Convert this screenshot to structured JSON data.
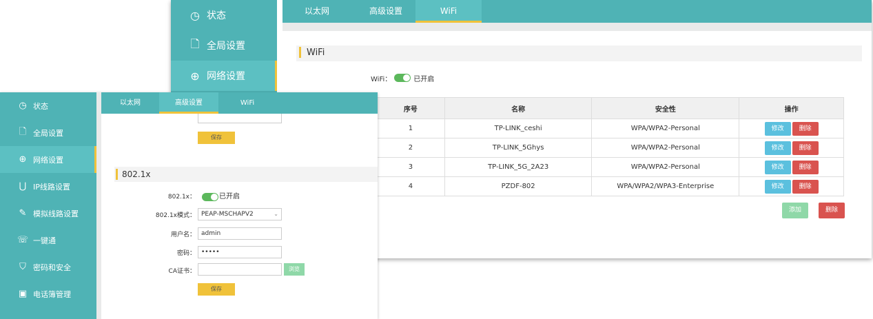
{
  "back": {
    "sidebar": [
      {
        "icon": "clock-icon",
        "glyph": "◷",
        "label": "状态"
      },
      {
        "icon": "settings-doc-icon",
        "glyph": "🗋",
        "label": "全局设置"
      },
      {
        "icon": "globe-icon",
        "glyph": "⊕",
        "label": "网络设置"
      }
    ],
    "tabs": [
      "以太网",
      "高级设置",
      "WiFi"
    ],
    "section_title": "WiFi",
    "wifi_label": "WiFi：",
    "wifi_state": "已开启",
    "table": {
      "headers": [
        "序号",
        "名称",
        "安全性",
        "操作"
      ],
      "rows": [
        {
          "no": "1",
          "name": "TP-LINK_ceshi",
          "security": "WPA/WPA2-Personal"
        },
        {
          "no": "2",
          "name": "TP-LINK_5Ghys",
          "security": "WPA/WPA2-Personal"
        },
        {
          "no": "3",
          "name": "TP-LINK_5G_2A23",
          "security": "WPA/WPA2-Personal"
        },
        {
          "no": "4",
          "name": "PZDF-802",
          "security": "WPA/WPA2/WPA3-Enterprise"
        }
      ],
      "edit_label": "修改",
      "delete_label": "删除"
    },
    "add_label": "添加",
    "delete_all_label": "删除"
  },
  "front": {
    "sidebar": [
      {
        "icon": "clock-icon",
        "glyph": "◷",
        "label": "状态"
      },
      {
        "icon": "settings-doc-icon",
        "glyph": "🗋",
        "label": "全局设置"
      },
      {
        "icon": "globe-icon",
        "glyph": "⊕",
        "label": "网络设置"
      },
      {
        "icon": "ip-line-icon",
        "glyph": "⋃",
        "label": "IP线路设置"
      },
      {
        "icon": "analog-line-icon",
        "glyph": "✎",
        "label": "模拟线路设置"
      },
      {
        "icon": "one-key-icon",
        "glyph": "☏",
        "label": "一键通"
      },
      {
        "icon": "shield-icon",
        "glyph": "⛉",
        "label": "密码和安全"
      },
      {
        "icon": "phonebook-icon",
        "glyph": "▣",
        "label": "电话簿管理"
      }
    ],
    "tabs": [
      "以太网",
      "高级设置",
      "WiFi"
    ],
    "save_label_top": "保存",
    "section_title": "802.1x",
    "fields": {
      "dot1x_label": "802.1x：",
      "dot1x_state": "已开启",
      "mode_label": "802.1x模式：",
      "mode_value": "PEAP-MSCHAPV2",
      "username_label": "用户名：",
      "username_value": "admin",
      "password_label": "密码：",
      "password_value": "•••••",
      "ca_label": "CA证书：",
      "ca_value": "",
      "browse_label": "浏览"
    },
    "save_label_bottom": "保存"
  },
  "colors": {
    "sidebar_teal": "#4fb3b5",
    "active_teal": "#5cc0c2",
    "accent_yellow": "#f0c23a",
    "edit_blue": "#5bc0de",
    "delete_red": "#d9534f",
    "add_green": "#8fd8a8",
    "toggle_green": "#5cb85c"
  }
}
